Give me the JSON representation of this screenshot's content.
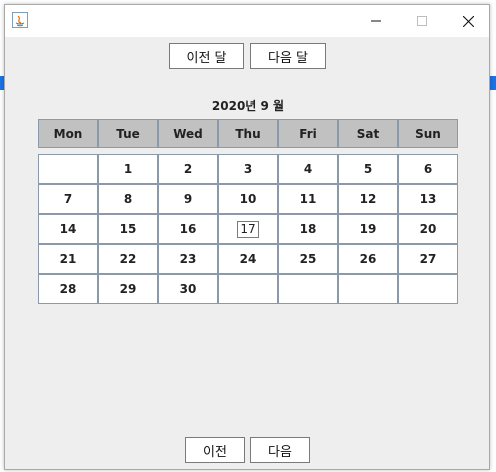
{
  "window": {
    "controls": {
      "minimize_icon": "minimize-icon",
      "maximize_icon": "maximize-icon",
      "close_icon": "close-icon"
    }
  },
  "nav": {
    "prev_month_label": "이전 달",
    "next_month_label": "다음 달"
  },
  "calendar": {
    "title": "2020년 9 월",
    "weekdays": [
      "Mon",
      "Tue",
      "Wed",
      "Thu",
      "Fri",
      "Sat",
      "Sun"
    ],
    "weeks": [
      [
        "",
        "1",
        "2",
        "3",
        "4",
        "5",
        "6"
      ],
      [
        "7",
        "8",
        "9",
        "10",
        "11",
        "12",
        "13"
      ],
      [
        "14",
        "15",
        "16",
        "17",
        "18",
        "19",
        "20"
      ],
      [
        "21",
        "22",
        "23",
        "24",
        "25",
        "26",
        "27"
      ],
      [
        "28",
        "29",
        "30",
        "",
        "",
        "",
        ""
      ]
    ],
    "highlighted_day": "17"
  },
  "footer": {
    "prev_label": "이전",
    "next_label": "다음"
  }
}
